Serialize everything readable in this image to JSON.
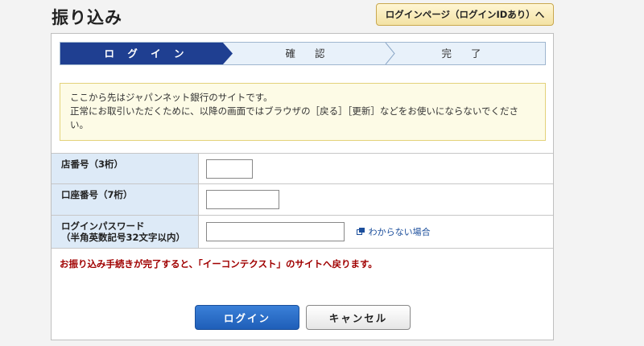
{
  "header": {
    "title": "振り込み",
    "login_id_button": "ログインページ（ログインIDあり）へ"
  },
  "steps": [
    {
      "label": "ロ グ イ ン",
      "active": true
    },
    {
      "label": "確 認",
      "active": false
    },
    {
      "label": "完 了",
      "active": false
    }
  ],
  "notice": {
    "line1": "ここから先はジャパンネット銀行のサイトです。",
    "line2": "正常にお取引いただくために、以降の画面ではブラウザの［戻る］［更新］などをお使いにならないでくださ",
    "line3": "い。"
  },
  "form": {
    "branch_label": "店番号（3桁）",
    "branch_value": "",
    "account_label": "口座番号（7桁）",
    "account_value": "",
    "password_label_line1": "ログインパスワード",
    "password_label_line2": "（半角英数記号32文字以内）",
    "password_value": "",
    "help_link": "わからない場合"
  },
  "complete_note": "お振り込み手続きが完了すると、「イーコンテクスト」のサイトへ戻ります。",
  "buttons": {
    "login": "ログイン",
    "cancel": "キャンセル"
  },
  "colors": {
    "active_step": "#1f3f91",
    "notice_bg": "#fdfbe6",
    "label_bg": "#ddeaf7",
    "note_red": "#a00000",
    "login_blue": "#2a6cc8"
  }
}
